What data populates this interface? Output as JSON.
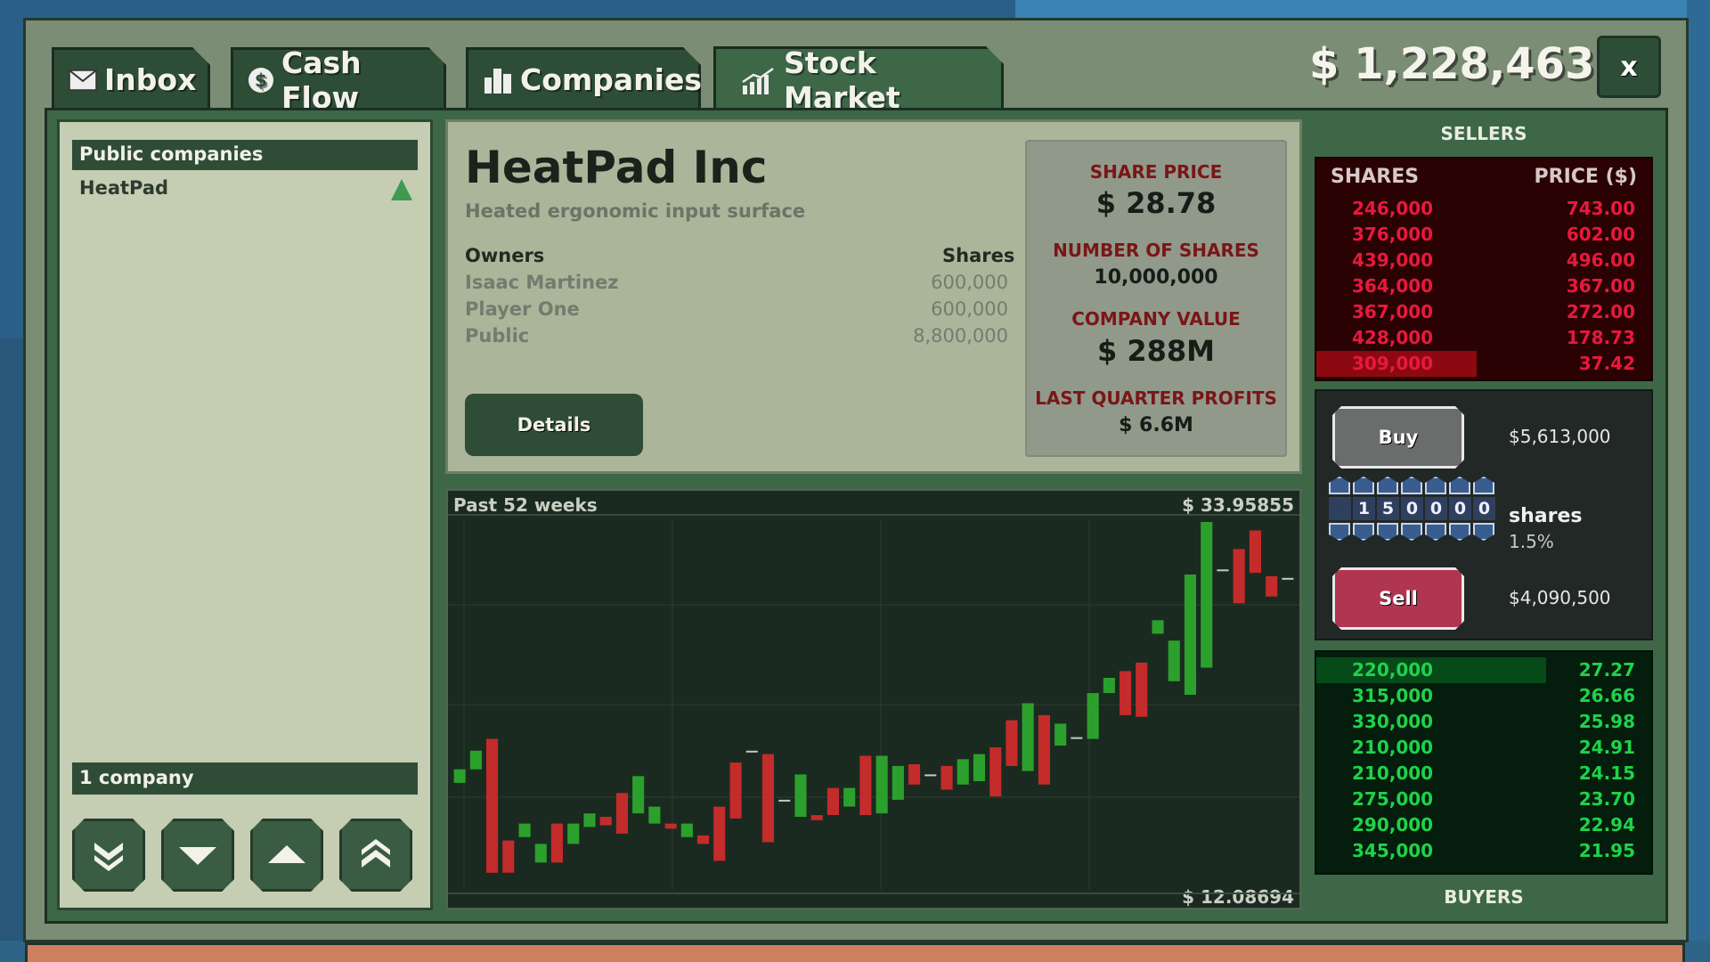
{
  "tabs": [
    {
      "label": "Inbox",
      "icon": "envelope-icon"
    },
    {
      "label": "Cash Flow",
      "icon": "dollar-coin-icon"
    },
    {
      "label": "Companies",
      "icon": "buildings-icon"
    },
    {
      "label": "Stock Market",
      "icon": "chart-up-icon",
      "active": true
    }
  ],
  "balance": "$ 1,228,463",
  "close_label": "x",
  "company_list": {
    "header": "Public companies",
    "items": [
      {
        "name": "HeatPad",
        "trend": "up"
      }
    ],
    "count_label": "1 company"
  },
  "company": {
    "name": "HeatPad Inc",
    "tagline": "Heated ergonomic input surface",
    "owners_header": "Owners",
    "shares_header": "Shares",
    "owners": [
      {
        "name": "Isaac Martinez",
        "shares": "600,000"
      },
      {
        "name": "Player One",
        "shares": "600,000"
      },
      {
        "name": "Public",
        "shares": "8,800,000"
      }
    ],
    "details_label": "Details"
  },
  "stats": {
    "share_price_label": "SHARE PRICE",
    "share_price": "$ 28.78",
    "num_shares_label": "NUMBER OF SHARES",
    "num_shares": "10,000,000",
    "company_value_label": "COMPANY VALUE",
    "company_value": "$ 288M",
    "profits_label": "LAST QUARTER PROFITS",
    "profits": "$ 6.6M"
  },
  "chart": {
    "period_label": "Past 52 weeks",
    "max_label": "$ 33.95855",
    "min_label": "$ 12.08694"
  },
  "chart_data": {
    "type": "candlestick",
    "title": "Past 52 weeks",
    "ylim": [
      12.08694,
      33.95855
    ],
    "open": [
      18.4,
      19.2,
      21.0,
      15.0,
      15.2,
      13.7,
      16.0,
      14.8,
      15.8,
      16.4,
      17.8,
      16.6,
      16.0,
      16.0,
      15.2,
      15.3,
      17.0,
      19.6,
      20.3,
      20.1,
      17.4,
      16.4,
      16.5,
      18.1,
      17.0,
      20.0,
      16.6,
      17.4,
      19.5,
      18.9,
      19.4,
      18.3,
      18.5,
      20.5,
      22.1,
      19.1,
      22.4,
      20.6,
      21.1,
      21.0,
      23.7,
      25.0,
      25.5,
      27.2,
      24.4,
      23.6,
      25.2,
      31.0,
      32.2,
      33.3,
      30.6,
      30.5
    ],
    "close": [
      19.2,
      20.3,
      13.1,
      13.1,
      16.0,
      14.8,
      13.7,
      16.0,
      16.6,
      15.9,
      15.4,
      18.8,
      17.0,
      15.7,
      16.0,
      14.8,
      13.8,
      16.3,
      20.3,
      14.9,
      17.4,
      18.9,
      16.2,
      16.5,
      18.1,
      16.5,
      20.0,
      19.4,
      18.3,
      18.9,
      18.0,
      19.8,
      20.1,
      17.6,
      19.4,
      23.1,
      18.3,
      21.9,
      21.1,
      23.7,
      24.6,
      22.4,
      22.3,
      28.0,
      26.8,
      30.7,
      33.8,
      31.0,
      29.0,
      30.8,
      29.4,
      30.5
    ]
  },
  "order_book": {
    "sellers_title": "SELLERS",
    "buyers_title": "BUYERS",
    "shares_header": "SHARES",
    "price_header": "PRICE ($)",
    "sells": [
      {
        "shares": "246,000",
        "price": "743.00"
      },
      {
        "shares": "376,000",
        "price": "602.00"
      },
      {
        "shares": "439,000",
        "price": "496.00"
      },
      {
        "shares": "364,000",
        "price": "367.00"
      },
      {
        "shares": "367,000",
        "price": "272.00"
      },
      {
        "shares": "428,000",
        "price": "178.73"
      },
      {
        "shares": "309,000",
        "price": "37.42"
      }
    ],
    "buys": [
      {
        "shares": "220,000",
        "price": "27.27"
      },
      {
        "shares": "315,000",
        "price": "26.66"
      },
      {
        "shares": "330,000",
        "price": "25.98"
      },
      {
        "shares": "210,000",
        "price": "24.91"
      },
      {
        "shares": "210,000",
        "price": "24.15"
      },
      {
        "shares": "275,000",
        "price": "23.70"
      },
      {
        "shares": "290,000",
        "price": "22.94"
      },
      {
        "shares": "345,000",
        "price": "21.95"
      }
    ]
  },
  "trade": {
    "buy_label": "Buy",
    "buy_cost": "$5,613,000",
    "digits": [
      "",
      "1",
      "5",
      "0",
      "0",
      "0",
      "0"
    ],
    "shares_label": "shares",
    "percent": "1.5%",
    "sell_label": "Sell",
    "sell_proceeds": "$4,090,500"
  },
  "colors": {
    "up": "#2ca02c",
    "down": "#c42b2b",
    "sell_text": "#e8193c",
    "buy_text": "#1fd24a"
  }
}
